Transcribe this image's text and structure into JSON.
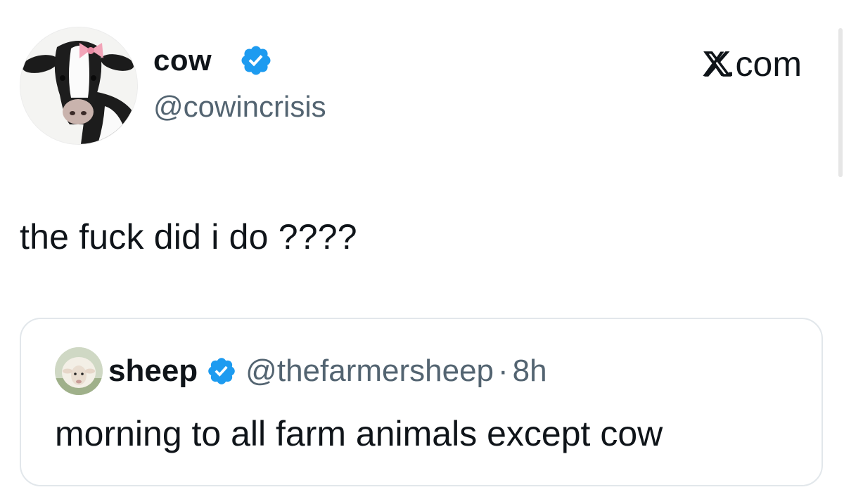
{
  "tweet": {
    "author": {
      "display_name": "cow",
      "handle": "@cowincrisis",
      "verified": true,
      "avatar_icon": "cow-with-pink-bow-avatar"
    },
    "source": "X.com",
    "text": "the fuck did i do ????"
  },
  "quoted_tweet": {
    "author": {
      "display_name": "sheep",
      "handle": "@thefarmersheep",
      "verified": true,
      "avatar_icon": "sheep-avatar"
    },
    "separator": "·",
    "time": "8h",
    "text": "morning to all farm animals except cow"
  },
  "colors": {
    "verified_badge": "#1d9bf0",
    "text_primary": "#0f1419",
    "text_secondary": "#536471",
    "card_border": "#e2e7eb",
    "bow_pink": "#f2a4b8"
  }
}
